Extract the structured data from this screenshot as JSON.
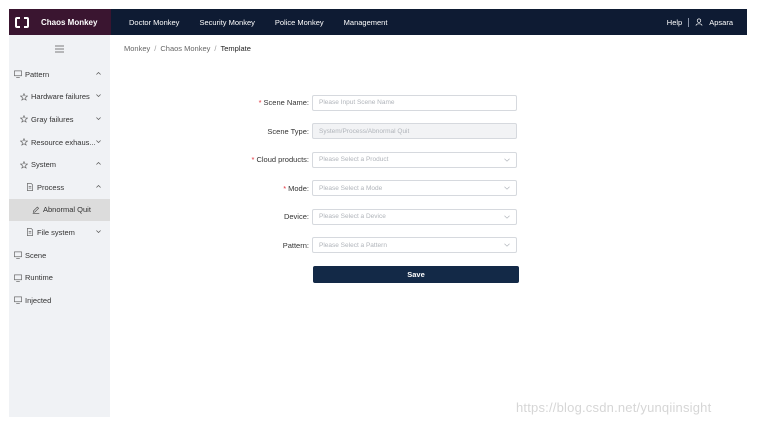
{
  "topbar": {
    "brand": "Chaos Monkey",
    "nav": [
      "Doctor Monkey",
      "Security Monkey",
      "Police Monkey",
      "Management"
    ],
    "help": "Help",
    "user": "Apsara"
  },
  "sidebar": {
    "items": [
      {
        "label": "Pattern",
        "level": 0,
        "icon": "monitor-icon",
        "chevron": "up"
      },
      {
        "label": "Hardware failures",
        "level": 1,
        "icon": "star-icon",
        "chevron": "down"
      },
      {
        "label": "Gray failures",
        "level": 1,
        "icon": "star-icon",
        "chevron": "down"
      },
      {
        "label": "Resource exhaus...",
        "level": 1,
        "icon": "star-icon",
        "chevron": "down"
      },
      {
        "label": "System",
        "level": 1,
        "icon": "star-icon",
        "chevron": "up"
      },
      {
        "label": "Process",
        "level": 2,
        "icon": "file-icon",
        "chevron": "up"
      },
      {
        "label": "Abnormal Quit",
        "level": 3,
        "icon": "edit-icon",
        "chevron": "",
        "active": true
      },
      {
        "label": "File system",
        "level": 2,
        "icon": "file-icon",
        "chevron": "down"
      },
      {
        "label": "Scene",
        "level": 0,
        "icon": "monitor-icon",
        "chevron": ""
      },
      {
        "label": "Runtime",
        "level": 0,
        "icon": "monitor-icon",
        "chevron": ""
      },
      {
        "label": "Injected",
        "level": 0,
        "icon": "monitor-icon",
        "chevron": ""
      }
    ]
  },
  "breadcrumb": [
    "Monkey",
    "Chaos Monkey",
    "Template"
  ],
  "form": {
    "fields": [
      {
        "label": "Scene Name",
        "required": true,
        "placeholder": "Please Input Scene Name",
        "type": "input",
        "disabled": false
      },
      {
        "label": "Scene Type",
        "required": false,
        "placeholder": "System/Process/Abnormal Quit",
        "type": "input",
        "disabled": true
      },
      {
        "label": "Cloud products",
        "required": true,
        "placeholder": "Please Select a Product",
        "type": "select",
        "disabled": false
      },
      {
        "label": "Mode",
        "required": true,
        "placeholder": "Please Select a Mode",
        "type": "select",
        "disabled": false
      },
      {
        "label": "Device",
        "required": false,
        "placeholder": "Please Select a Device",
        "type": "select",
        "disabled": false
      },
      {
        "label": "Pattern",
        "required": false,
        "placeholder": "Please Select a Pattern",
        "type": "select",
        "disabled": false
      }
    ],
    "save_label": "Save"
  },
  "watermark": "https://blog.csdn.net/yunqiinsight",
  "colors": {
    "topbar": "#0e1b33",
    "brand_bg": "#3a1530",
    "button": "#132947",
    "required": "#e0303a"
  }
}
